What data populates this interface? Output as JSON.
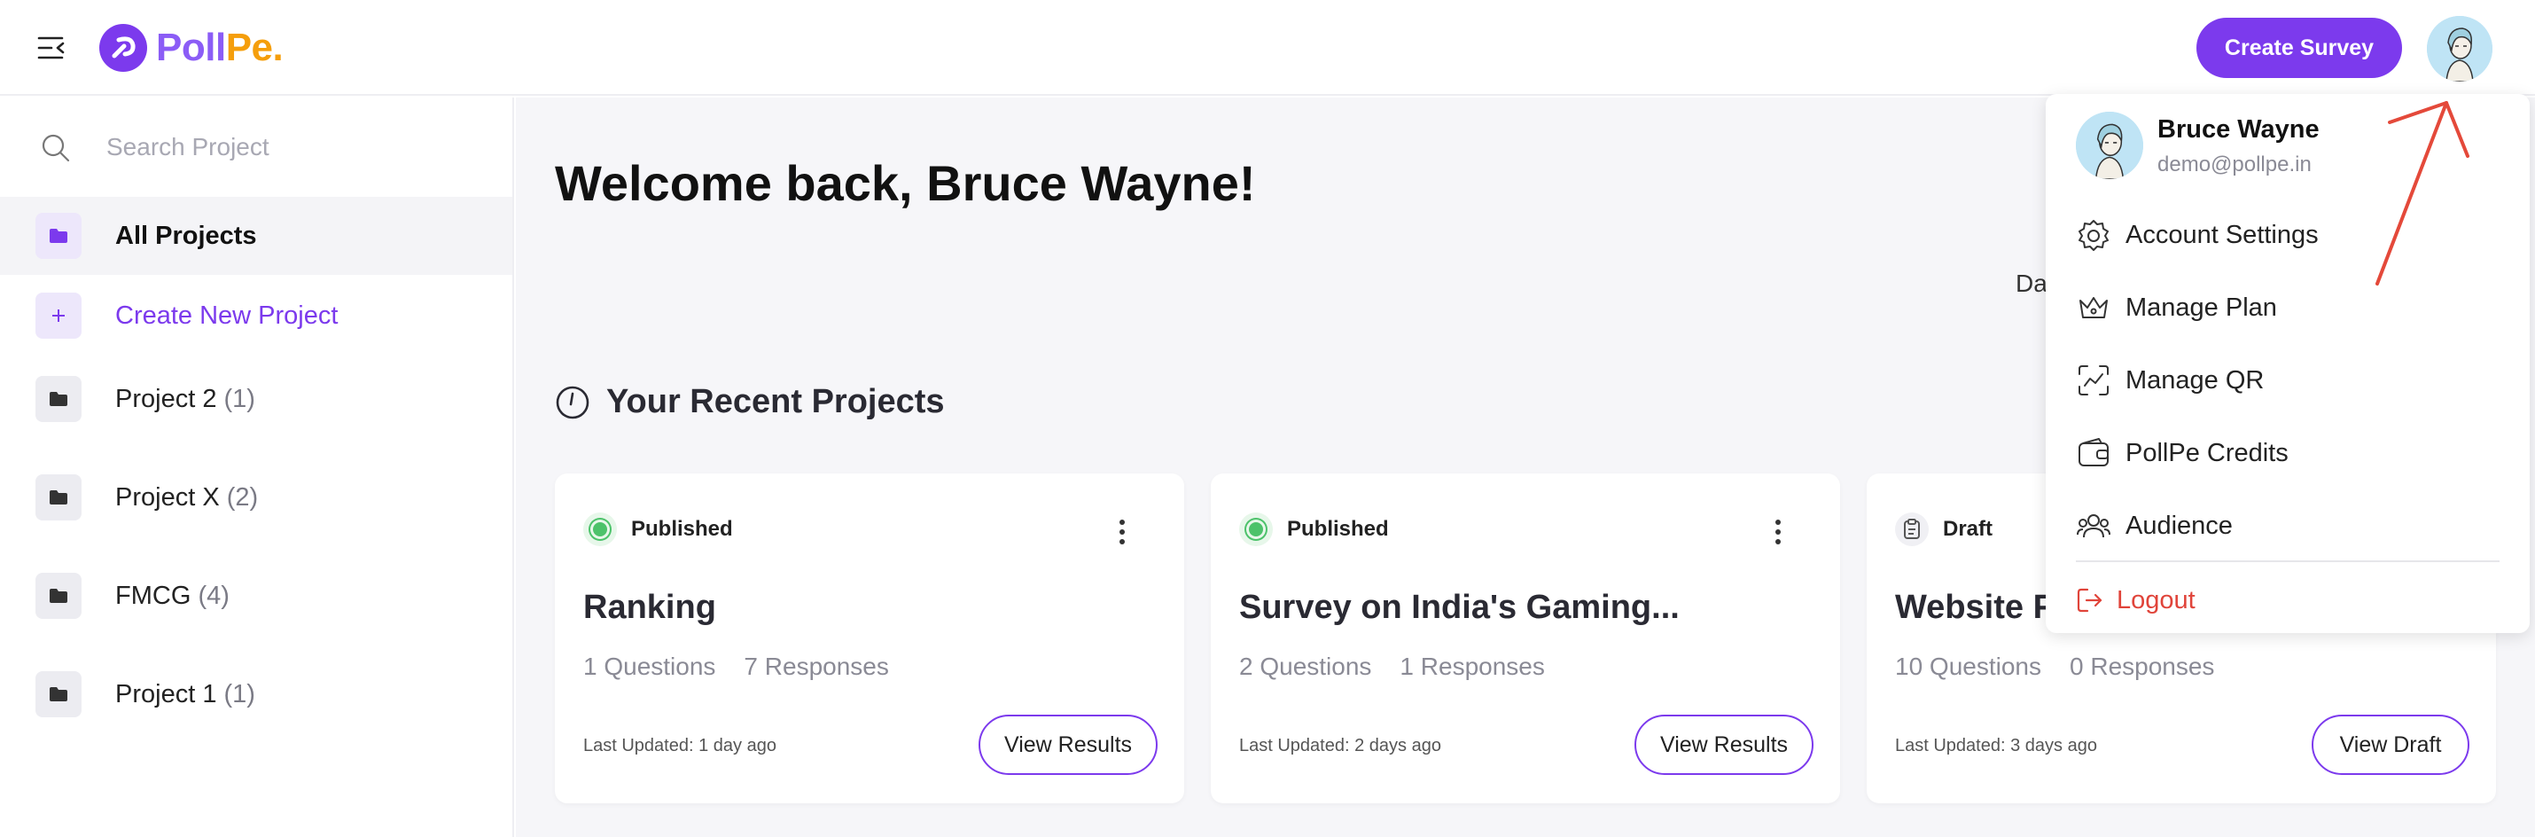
{
  "app": {
    "logo_part1": "Poll",
    "logo_part2": "Pe."
  },
  "header": {
    "create_survey_label": "Create Survey"
  },
  "sidebar": {
    "search_placeholder": "Search Project",
    "all_projects": "All Projects",
    "create_new": "Create New Project",
    "projects": [
      {
        "name": "Project 2",
        "count": "(1)"
      },
      {
        "name": "Project X",
        "count": "(2)"
      },
      {
        "name": "FMCG",
        "count": "(4)"
      },
      {
        "name": "Project 1",
        "count": "(1)"
      }
    ]
  },
  "main": {
    "welcome": "Welcome back, Bruce Wayne!",
    "partial_text": "Da",
    "recent_title": "Your Recent Projects",
    "cards": [
      {
        "status": "Published",
        "title": "Ranking",
        "questions": "1 Questions",
        "responses": "7 Responses",
        "updated": "Last Updated: 1 day ago",
        "button": "View Results"
      },
      {
        "status": "Published",
        "title": "Survey on India's Gaming...",
        "questions": "2 Questions",
        "responses": "1 Responses",
        "updated": "Last Updated: 2 days ago",
        "button": "View Results"
      },
      {
        "status": "Draft",
        "title": "Website F",
        "questions": "10 Questions",
        "responses": "0 Responses",
        "updated": "Last Updated: 3 days ago",
        "button": "View Draft"
      }
    ]
  },
  "dropdown": {
    "name": "Bruce Wayne",
    "email": "demo@pollpe.in",
    "items": [
      "Account Settings",
      "Manage Plan",
      "Manage QR",
      "PollPe Credits",
      "Audience"
    ],
    "logout": "Logout"
  },
  "colors": {
    "accent": "#7c3aed",
    "logout": "#e0443a",
    "published": "#4cc26a",
    "annotation_arrow": "#e4493a"
  }
}
